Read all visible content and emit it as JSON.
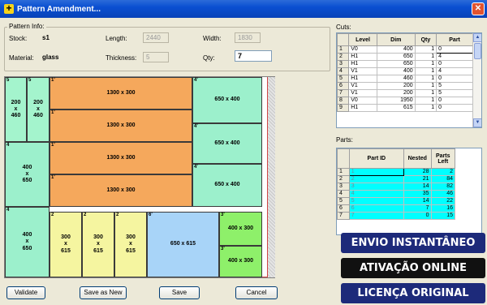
{
  "window": {
    "title": "Pattern Amendment...",
    "close_glyph": "✕",
    "icon_glyph": "+"
  },
  "pattern_info": {
    "title": "Pattern Info:",
    "stock_label": "Stock:",
    "stock_value": "s1",
    "material_label": "Material:",
    "material_value": "glass",
    "length_label": "Length:",
    "length_value": "2440",
    "thickness_label": "Thickness:",
    "thickness_value": "5",
    "width_label": "Width:",
    "width_value": "1830",
    "qty_label": "Qty:",
    "qty_value": "7"
  },
  "layout_pieces": [
    {
      "tag": "5",
      "label": "200\nx\n460",
      "color": "#a4f4cd"
    },
    {
      "tag": "5",
      "label": "200\nx\n460",
      "color": "#a4f4cd"
    },
    {
      "tag": "1'",
      "label": "1300 x 300",
      "color": "#f5a85c"
    },
    {
      "tag": "1'",
      "label": "1300 x 300",
      "color": "#f5a85c"
    },
    {
      "tag": "1'",
      "label": "1300 x 300",
      "color": "#f5a85c"
    },
    {
      "tag": "1'",
      "label": "1300 x 300",
      "color": "#f5a85c"
    },
    {
      "tag": "4'",
      "label": "650 x 400",
      "color": "#9cf0cc"
    },
    {
      "tag": "4'",
      "label": "650 x 400",
      "color": "#9cf0cc"
    },
    {
      "tag": "4'",
      "label": "650 x 400",
      "color": "#9cf0cc"
    },
    {
      "tag": "4",
      "label": "400\nx\n650",
      "color": "#9cf0cc"
    },
    {
      "tag": "4",
      "label": "400\nx\n650",
      "color": "#9cf0cc"
    },
    {
      "tag": "2",
      "label": "300\nx\n615",
      "color": "#f5f5a0"
    },
    {
      "tag": "2",
      "label": "300\nx\n615",
      "color": "#f5f5a0"
    },
    {
      "tag": "2",
      "label": "300\nx\n615",
      "color": "#f5f5a0"
    },
    {
      "tag": "6'",
      "label": "650 x 615",
      "color": "#a8d4f8"
    },
    {
      "tag": "3'",
      "label": "400 x 300",
      "color": "#8ef06a"
    },
    {
      "tag": "3'",
      "label": "400 x 300",
      "color": "#8ef06a"
    }
  ],
  "cuts": {
    "title": "Cuts:",
    "columns": [
      "",
      "Level",
      "Dim",
      "Qty",
      "Part"
    ],
    "rows": [
      [
        "1",
        "V0",
        "400",
        "1",
        "0"
      ],
      [
        "2",
        "H1",
        "650",
        "1",
        "4"
      ],
      [
        "3",
        "H1",
        "650",
        "1",
        "0"
      ],
      [
        "4",
        "V1",
        "400",
        "1",
        "4"
      ],
      [
        "5",
        "H1",
        "460",
        "1",
        "0"
      ],
      [
        "6",
        "V1",
        "200",
        "1",
        "5"
      ],
      [
        "7",
        "V1",
        "200",
        "1",
        "5"
      ],
      [
        "8",
        "V0",
        "1950",
        "1",
        "0"
      ],
      [
        "9",
        "H1",
        "615",
        "1",
        "0"
      ]
    ]
  },
  "parts": {
    "title": "Parts:",
    "columns": [
      "",
      "Part ID",
      "Nested",
      "Parts Left"
    ],
    "rows": [
      [
        "1",
        "1",
        "28",
        "2"
      ],
      [
        "2",
        "2",
        "21",
        "84"
      ],
      [
        "3",
        "3",
        "14",
        "82"
      ],
      [
        "4",
        "4",
        "35",
        "46"
      ],
      [
        "5",
        "5",
        "14",
        "22"
      ],
      [
        "6",
        "6",
        "7",
        "16"
      ],
      [
        "7",
        "7",
        "0",
        "15"
      ]
    ],
    "row_color": "#00ffff"
  },
  "buttons": {
    "validate": "Validate",
    "save_as_new": "Save as New",
    "save": "Save",
    "cancel": "Cancel"
  },
  "banners": [
    {
      "text": "ENVIO INSTANTÂNEO",
      "color": "#1d2a7a"
    },
    {
      "text": "ATIVAÇÃO ONLINE",
      "color": "#111111"
    },
    {
      "text": "LICENÇA ORIGINAL",
      "color": "#1d2a7a"
    }
  ]
}
